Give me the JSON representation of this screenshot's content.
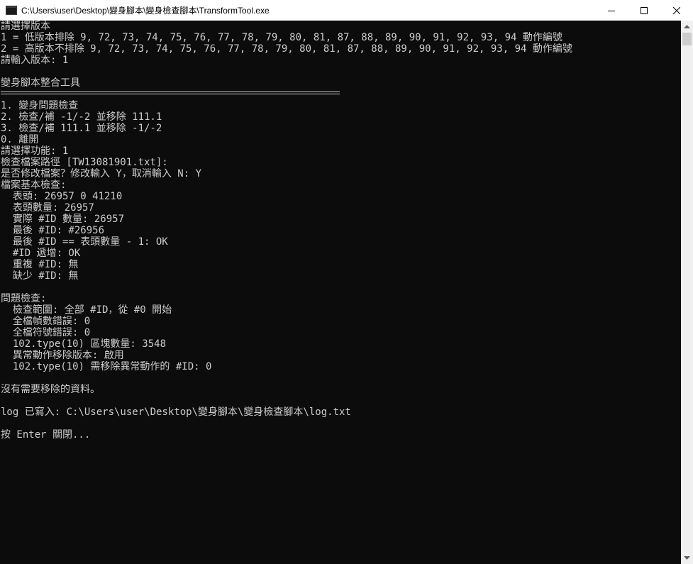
{
  "window": {
    "title": "C:\\Users\\user\\Desktop\\變身腳本\\變身檢查腳本\\TransformTool.exe",
    "icon": "console-app-icon",
    "controls": [
      "minimize-icon",
      "maximize-icon",
      "close-icon"
    ]
  },
  "console": {
    "lines": [
      "請選擇版本",
      "1 = 低版本排除 9, 72, 73, 74, 75, 76, 77, 78, 79, 80, 81, 87, 88, 89, 90, 91, 92, 93, 94 動作編號",
      "2 = 高版本不排除 9, 72, 73, 74, 75, 76, 77, 78, 79, 80, 81, 87, 88, 89, 90, 91, 92, 93, 94 動作編號",
      "請輸入版本: 1",
      "",
      "變身腳本整合工具",
      "",
      "1. 變身問題檢查",
      "2. 檢查/補 -1/-2 並移除 111.1",
      "3. 檢查/補 111.1 並移除 -1/-2",
      "0. 離開",
      "請選擇功能: 1",
      "檢查檔案路徑 [TW13081901.txt]:",
      "是否修改檔案？修改輸入 Y，取消輸入 N: Y",
      "檔案基本檢查:",
      "  表頭: 26957 0 41210",
      "  表頭數量: 26957",
      "  實際 #ID 數量: 26957",
      "  最後 #ID: #26956",
      "  最後 #ID == 表頭數量 - 1: OK",
      "  #ID 遞增: OK",
      "  重複 #ID: 無",
      "  缺少 #ID: 無",
      "",
      "問題檢查:",
      "  檢查範圍: 全部 #ID，從 #0 開始",
      "  全檔幀數錯誤: 0",
      "  全檔符號錯誤: 0",
      "  102.type(10) 區塊數量: 3548",
      "  異常動作移除版本: 啟用",
      "  102.type(10) 需移除異常動作的 #ID: 0",
      "",
      "沒有需要移除的資料。",
      "",
      "log 已寫入: C:\\Users\\user\\Desktop\\變身腳本\\變身檢查腳本\\log.txt",
      "",
      "按 Enter 關閉..."
    ]
  },
  "colors": {
    "background": "#0c0c0c",
    "text": "#cccccc",
    "titlebar": "#ffffff"
  }
}
